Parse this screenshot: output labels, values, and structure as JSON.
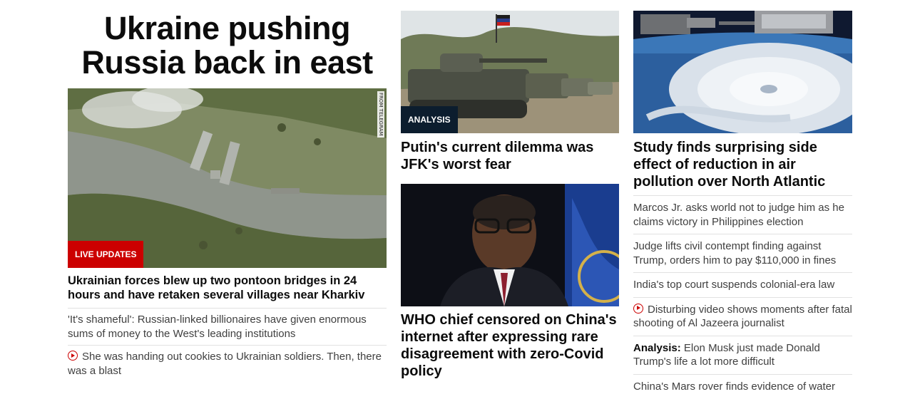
{
  "col1": {
    "title_line1": "Ukraine pushing",
    "title_line2": "Russia back in east",
    "image_tag": "LIVE UPDATES",
    "image_credit": "FROM TELEGRAM",
    "headline": "Ukrainian forces blew up two pontoon bridges in 24 hours and have retaken several villages near Kharkiv",
    "links": [
      {
        "text": "'It's shameful': Russian-linked billionaires have given enormous sums of money to the West's leading institutions",
        "video": false
      },
      {
        "text": "She was handing out cookies to Ukrainian soldiers. Then, there was a blast",
        "video": true
      }
    ]
  },
  "col2": {
    "card1": {
      "tag": "ANALYSIS",
      "headline": "Putin's current dilemma was JFK's worst fear"
    },
    "card2": {
      "headline": "WHO chief censored on China's internet after expressing rare disagreement with zero-Covid policy"
    }
  },
  "col3": {
    "headline": "Study finds surprising side effect of reduction in air pollution over North Atlantic",
    "links": [
      {
        "prefix": "",
        "text": "Marcos Jr. asks world not to judge him as he claims victory in Philippines election",
        "video": false
      },
      {
        "prefix": "",
        "text": "Judge lifts civil contempt finding against Trump, orders him to pay $110,000 in fines",
        "video": false
      },
      {
        "prefix": "",
        "text": "India's top court suspends colonial-era law",
        "video": false
      },
      {
        "prefix": "",
        "text": "Disturbing video shows moments after fatal shooting of Al Jazeera journalist",
        "video": true
      },
      {
        "prefix": "Analysis:",
        "text": "Elon Musk just made Donald Trump's life a lot more difficult",
        "video": false
      },
      {
        "prefix": "",
        "text": "China's Mars rover finds evidence of water",
        "video": false
      }
    ]
  },
  "icons": {
    "video": "play-circle-icon"
  },
  "colors": {
    "live": "#cc0000",
    "analysis": "#0c1d2e",
    "text": "#0c0c0c",
    "link": "#404040",
    "divider": "#e1e1e1"
  }
}
